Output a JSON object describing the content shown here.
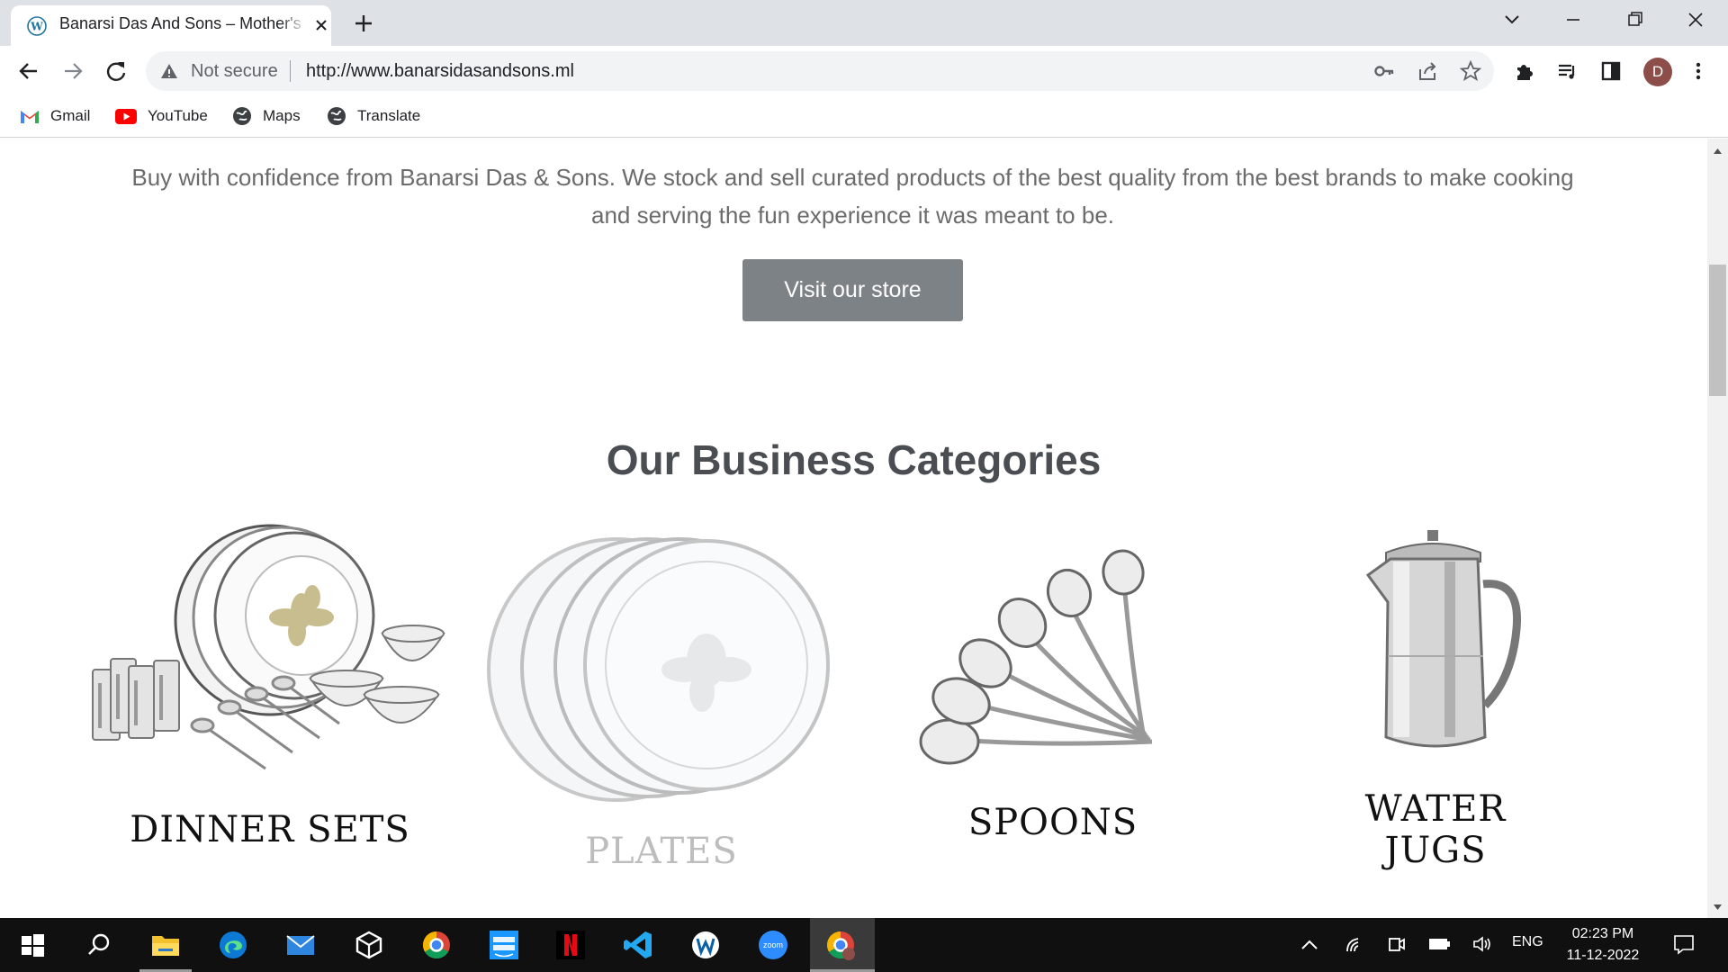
{
  "browser": {
    "tab_title": "Banarsi Das And Sons – Mother's",
    "security_label": "Not secure",
    "url": "http://www.banarsidasandsons.ml",
    "profile_initial": "D",
    "bookmarks": [
      "Gmail",
      "YouTube",
      "Maps",
      "Translate"
    ]
  },
  "page": {
    "intro_line1": "Buy with confidence from Banarsi Das & Sons. We stock and sell curated products of the best quality from the best brands to make cooking",
    "intro_line2": "and serving the fun experience it was meant to be.",
    "visit_button": "Visit our store",
    "section_heading": "Our Business Categories",
    "categories": [
      "DINNER SETS",
      "PLATES",
      "SPOONS",
      "WATER JUGS"
    ]
  },
  "taskbar": {
    "apps": [
      "start-icon",
      "search-icon",
      "file-explorer-icon",
      "edge-icon",
      "mail-icon",
      "unity-icon",
      "chrome-icon",
      "prime-video-icon",
      "netflix-icon",
      "vscode-icon",
      "wordpad-icon",
      "zoom-icon",
      "chrome-profile-icon"
    ],
    "language": "ENG",
    "time": "02:23 PM",
    "date": "11-12-2022"
  },
  "colors": {
    "tabstrip": "#dee1e6",
    "button": "#7d8287",
    "heading": "#4a4e52",
    "taskbar": "#101010"
  }
}
